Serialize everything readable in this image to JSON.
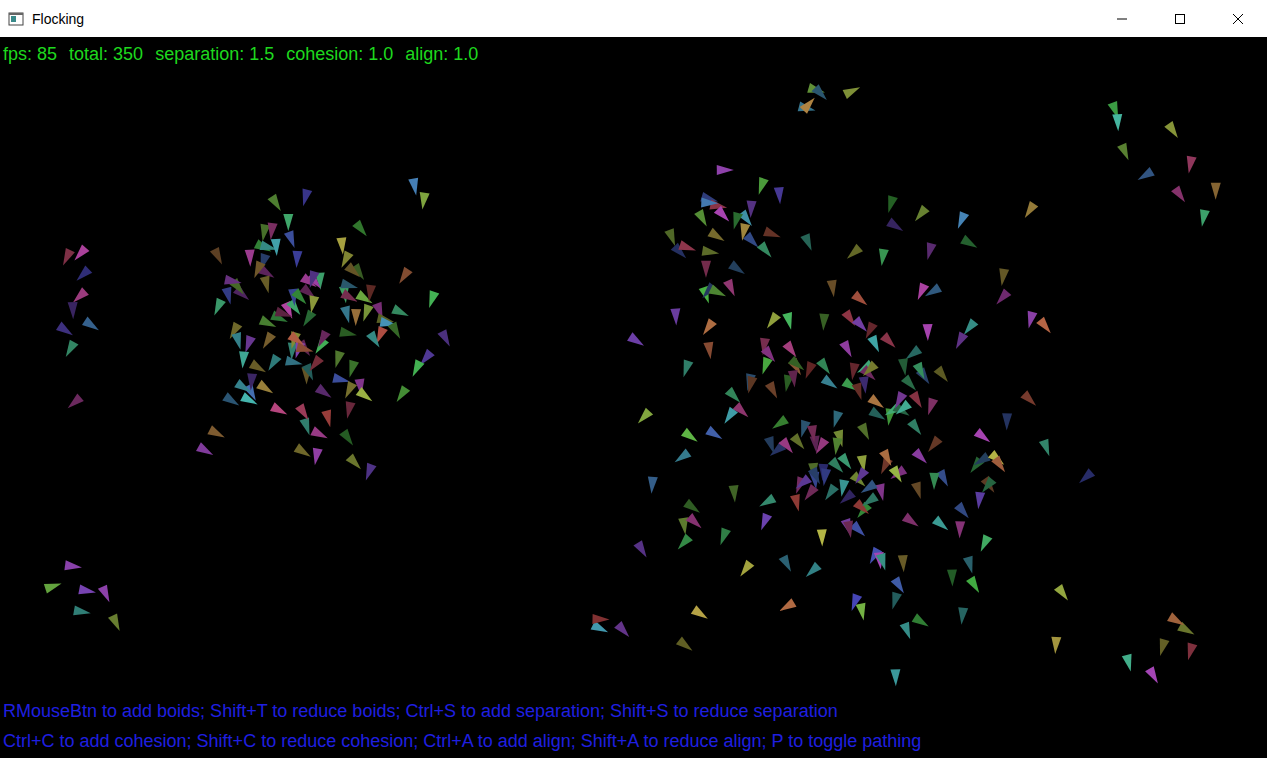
{
  "window": {
    "title": "Flocking"
  },
  "stats": [
    {
      "label": "fps:",
      "value": "85"
    },
    {
      "label": "total:",
      "value": "350"
    },
    {
      "label": "separation:",
      "value": "1.5"
    },
    {
      "label": "cohesion:",
      "value": "1.0"
    },
    {
      "label": "align:",
      "value": "1.0"
    }
  ],
  "help": [
    "RMouseBtn to add boids; Shift+T to reduce boids; Ctrl+S to add separation; Shift+S to reduce separation",
    "Ctrl+C to add cohesion; Shift+C to reduce cohesion; Ctrl+A to add align; Shift+A to reduce align; P to toggle pathing"
  ]
}
